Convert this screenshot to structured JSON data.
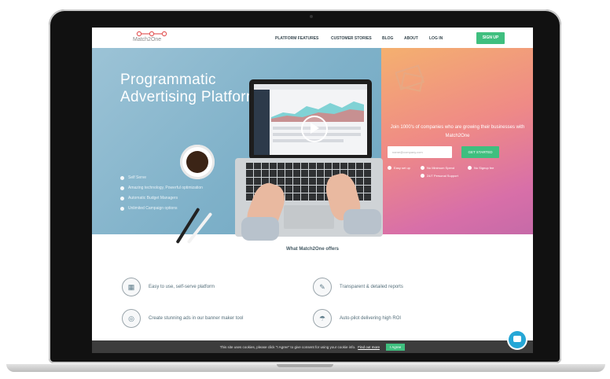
{
  "nav": {
    "logo": "Match2One",
    "links": [
      "PLATFORM FEATURES",
      "CUSTOMER STORIES",
      "BLOG",
      "ABOUT",
      "LOG IN"
    ],
    "signup": "SIGN UP"
  },
  "hero": {
    "title": "Programmatic Advertising Platform",
    "bullets": [
      "Self Serve",
      "Amazing technology, Powerful optimization",
      "Automatic Budget Managers",
      "Unlimited Campaign options"
    ]
  },
  "signup_panel": {
    "headline": "Join 1000's of companies who are growing their businesses with Match2One",
    "email_placeholder": "name@company.com",
    "start_button": "GET STARTED",
    "options": [
      "Easy set up",
      "No Minimum Spend",
      "No Signup fee",
      "24/7 Personal Support"
    ]
  },
  "offers": {
    "title": "What Match2One offers",
    "features": [
      {
        "icon": "panel-icon",
        "glyph": "▦",
        "text": "Easy to use, self-serve platform"
      },
      {
        "icon": "report-icon",
        "glyph": "✎",
        "text": "Transparent & detailed reports"
      },
      {
        "icon": "banner-icon",
        "glyph": "◎",
        "text": "Create stunning ads in our banner maker tool"
      },
      {
        "icon": "roi-icon",
        "glyph": "☂",
        "text": "Auto-pilot delivering high ROI"
      }
    ]
  },
  "cookie": {
    "text": "This site uses cookies, please click \"I Agree\" to give consent for using your cookie info.",
    "link": "Find out more",
    "button": "I Agree"
  },
  "colors": {
    "accent": "#3fbf7f",
    "hero_blue": "#7fb1c9",
    "hero_pink": "#ef8a86",
    "chat": "#26a7d6"
  }
}
